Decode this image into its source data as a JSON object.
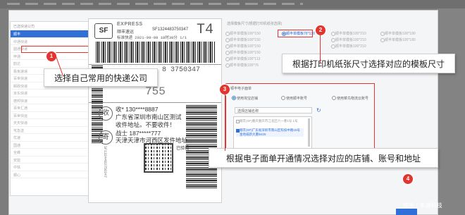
{
  "left_panel": {
    "title": "已选快递公司",
    "selected": "顺丰",
    "items": [
      "顺丰",
      "中通快递",
      "圆通快递",
      "申通",
      "韵达",
      "极兔速递",
      "百世快递",
      "邮政快递",
      "京东快递",
      "德邦快递",
      "百世汇通",
      "百世快运",
      "天天快递",
      "宅急送",
      "优速",
      "国通",
      "全峰",
      "安能",
      "中铁",
      "顺心"
    ]
  },
  "waybill": {
    "logo": "SF",
    "express": "EXPRESS",
    "brand": "顺丰速运",
    "number_top": "SF1324483750347",
    "region_code": "T4",
    "meta": "标准快递    2021-09-09 18时39分  1/1",
    "number_mid": "8 3750347",
    "sort_code": "755",
    "recv_circle": "收",
    "recv_name": "收* 130****8887",
    "recv_addr1": "广东省深圳市南山区测试",
    "recv_addr2": "收件地址。不要收件！",
    "send_circle": "寄",
    "send_name": "战士 187*****777",
    "send_addr": "天津天津市河西区发件地址",
    "signed": "已验视",
    "vertical_no": "SF1324483750347"
  },
  "size_panel": {
    "title": "选择模板尺寸(根据打印机纸张选择)",
    "options": [
      [
        "顺丰单模板100*150",
        "顺丰单模板76*130",
        "顺丰单模板100*210",
        "顺丰单模板100*180"
      ],
      [
        "顺丰单模板100*150",
        "",
        "顺丰单模板100*210",
        "顺丰单模板100*180"
      ],
      [
        "顺丰单模板100*150",
        "",
        "顺丰单模板100*210",
        ""
      ],
      [
        "顺丰单模板100*150",
        "",
        "",
        ""
      ],
      [
        "顺丰单模板100*113",
        "",
        "",
        ""
      ],
      [
        "顺丰单模板100*76",
        "",
        "",
        ""
      ]
    ],
    "selected": "顺丰单模板76*130"
  },
  "ewaybill": {
    "title": "顺丰电子面单",
    "options": [
      "使用淘宝店铺",
      "使用顺丰账号",
      "使用菜鸟物流云账号"
    ],
    "selected_option": "使用淘宝店铺",
    "select_value": "选择店铺名称",
    "addresses": [
      "顺丰(SF)重庆重庆市江北区六一巷1号 1号",
      "顺丰(SF)广东省深圳市南山区科技中路15号 金地威新大厦B425"
    ],
    "selected_address": 1
  },
  "callouts": {
    "c1": {
      "num": "1",
      "text": "选择自己常用的快递公司"
    },
    "c2": {
      "num": "2",
      "text": "根据打印机纸张尺寸选择对应的模板尺寸"
    },
    "c3": {
      "num": "3",
      "text": "根据电子面单开通情况选择对应的店铺、账号和地址"
    },
    "c4": {
      "num": "4"
    }
  },
  "watermark": "知乎 | 丰速科技",
  "colors": {
    "accent": "#e3342f",
    "primary": "#2f6fd6"
  }
}
